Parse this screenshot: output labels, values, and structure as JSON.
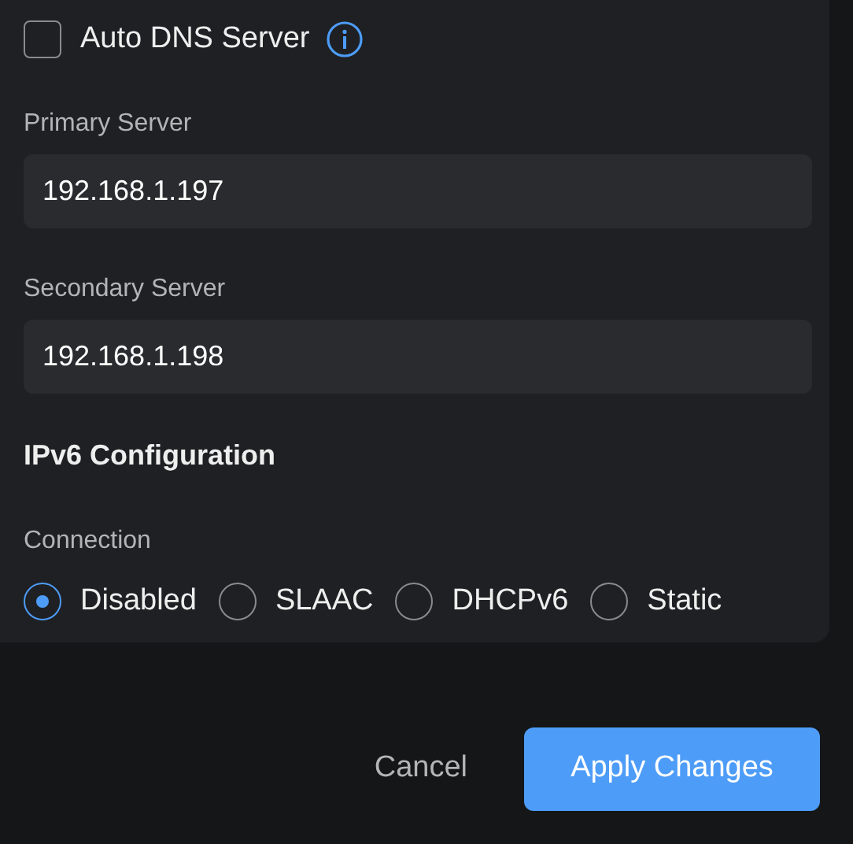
{
  "auto_dns": {
    "label": "Auto DNS Server",
    "checked": false
  },
  "fields": [
    {
      "label": "Primary Server",
      "value": "192.168.1.197"
    },
    {
      "label": "Secondary Server",
      "value": "192.168.1.198"
    }
  ],
  "ipv6": {
    "heading": "IPv6 Configuration",
    "connection_label": "Connection",
    "options": [
      {
        "label": "Disabled",
        "selected": true
      },
      {
        "label": "SLAAC",
        "selected": false
      },
      {
        "label": "DHCPv6",
        "selected": false
      },
      {
        "label": "Static",
        "selected": false
      }
    ]
  },
  "buttons": [
    {
      "label": "Cancel",
      "kind": "secondary"
    },
    {
      "label": "Apply Changes",
      "kind": "primary"
    }
  ]
}
